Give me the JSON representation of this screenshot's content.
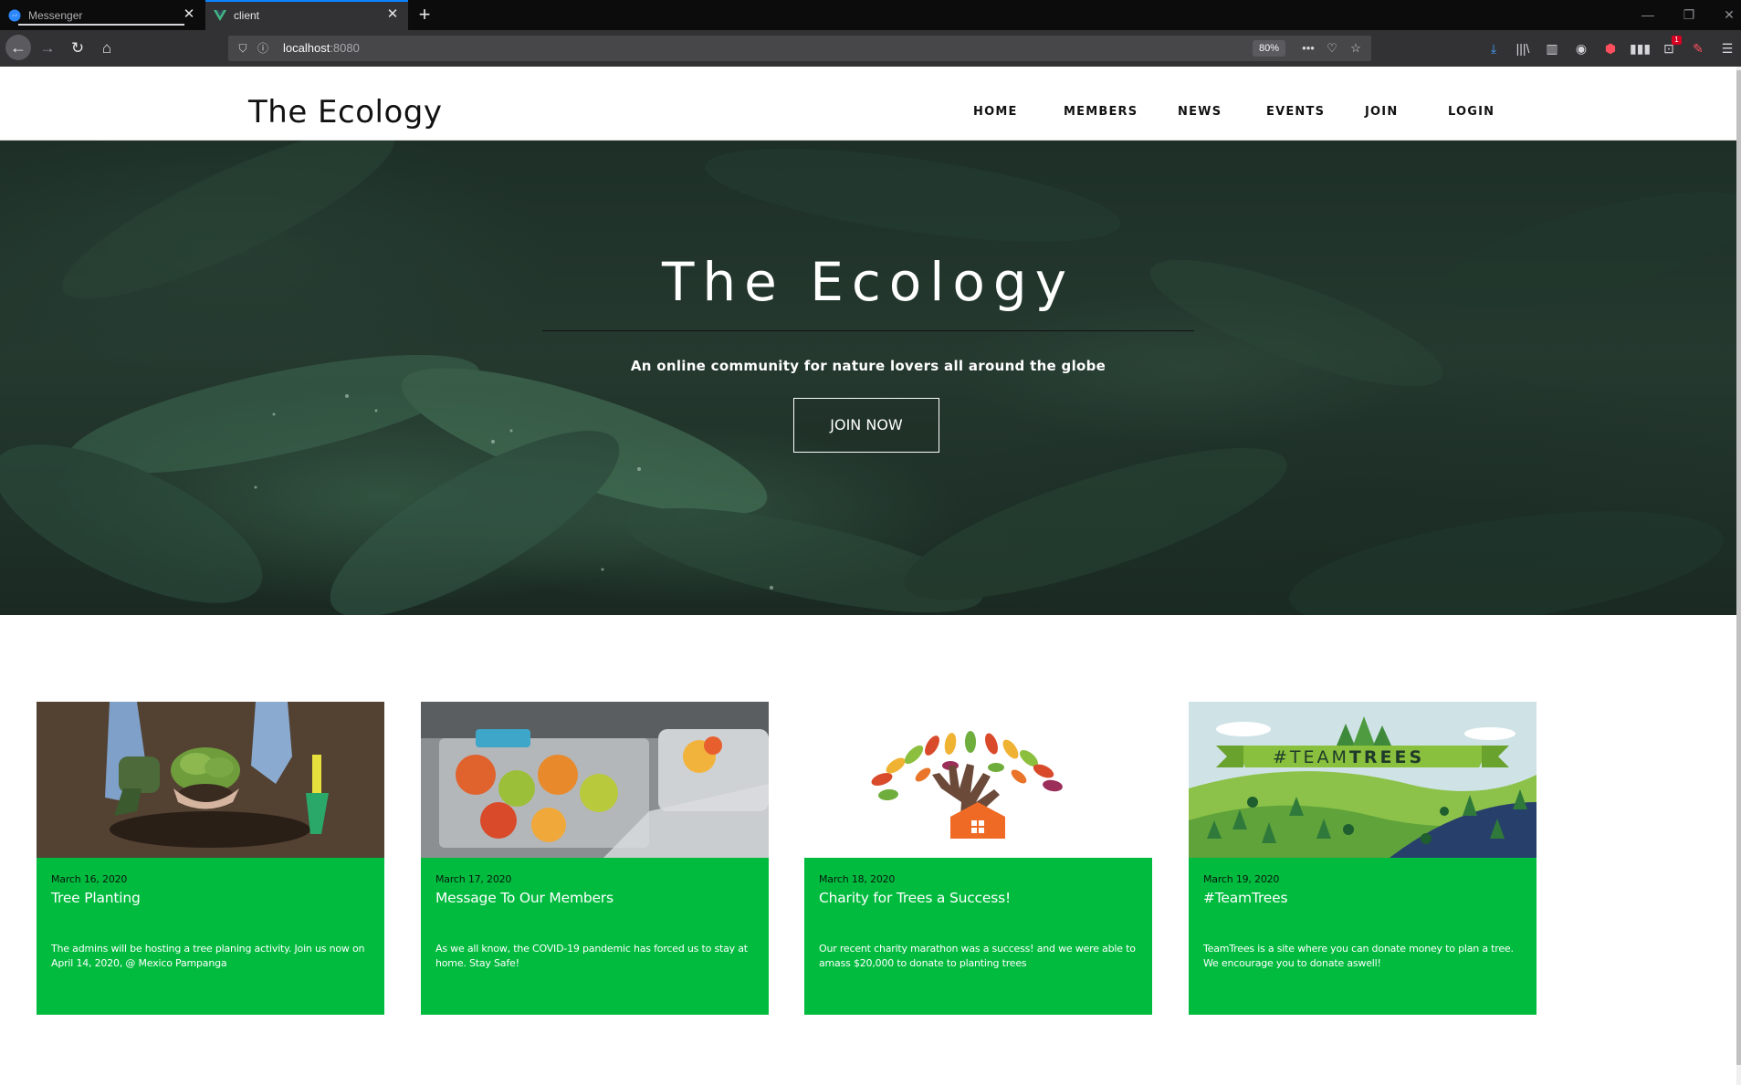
{
  "browser": {
    "tabs": [
      {
        "title": "Messenger",
        "active": false
      },
      {
        "title": "client",
        "active": true
      }
    ],
    "url_host": "localhost",
    "url_port": ":8080",
    "zoom": "80%",
    "notification_badge": "1"
  },
  "site": {
    "logo": "The Ecology",
    "nav": [
      "HOME",
      "MEMBERS",
      "NEWS",
      "EVENTS",
      "JOIN",
      "LOGIN"
    ]
  },
  "hero": {
    "title": "The Ecology",
    "subtitle": "An online community for nature lovers all around the globe",
    "cta": "JOIN NOW"
  },
  "news": [
    {
      "date": "March 16, 2020",
      "title": "Tree Planting",
      "text": "The admins will be hosting a tree planing activity. Join us now on April 14, 2020, @ Mexico Pampanga",
      "image": "hands-planting-seedling"
    },
    {
      "date": "March 17, 2020",
      "title": "Message To Our Members",
      "text": "As we all know, the COVID-19 pandemic has forced us to stay at home. Stay Safe!",
      "image": "food-tray-buffet"
    },
    {
      "date": "March 18, 2020",
      "title": "Charity for Trees a Success!",
      "text": "Our recent charity marathon was a success! and we were able to amass $20,000 to donate to planting trees",
      "image": "tree-hands-logo"
    },
    {
      "date": "March 19, 2020",
      "title": "#TeamTrees",
      "text": "TeamTrees is a site where you can donate money to plan a tree. We encourage you to donate aswell!",
      "image": "teamtrees-banner",
      "image_text_a": "#TEAM",
      "image_text_b": "TREES"
    }
  ],
  "colors": {
    "card_green": "#00bb3e",
    "tab_accent": "#0a84ff",
    "toolbar": "#323234"
  }
}
